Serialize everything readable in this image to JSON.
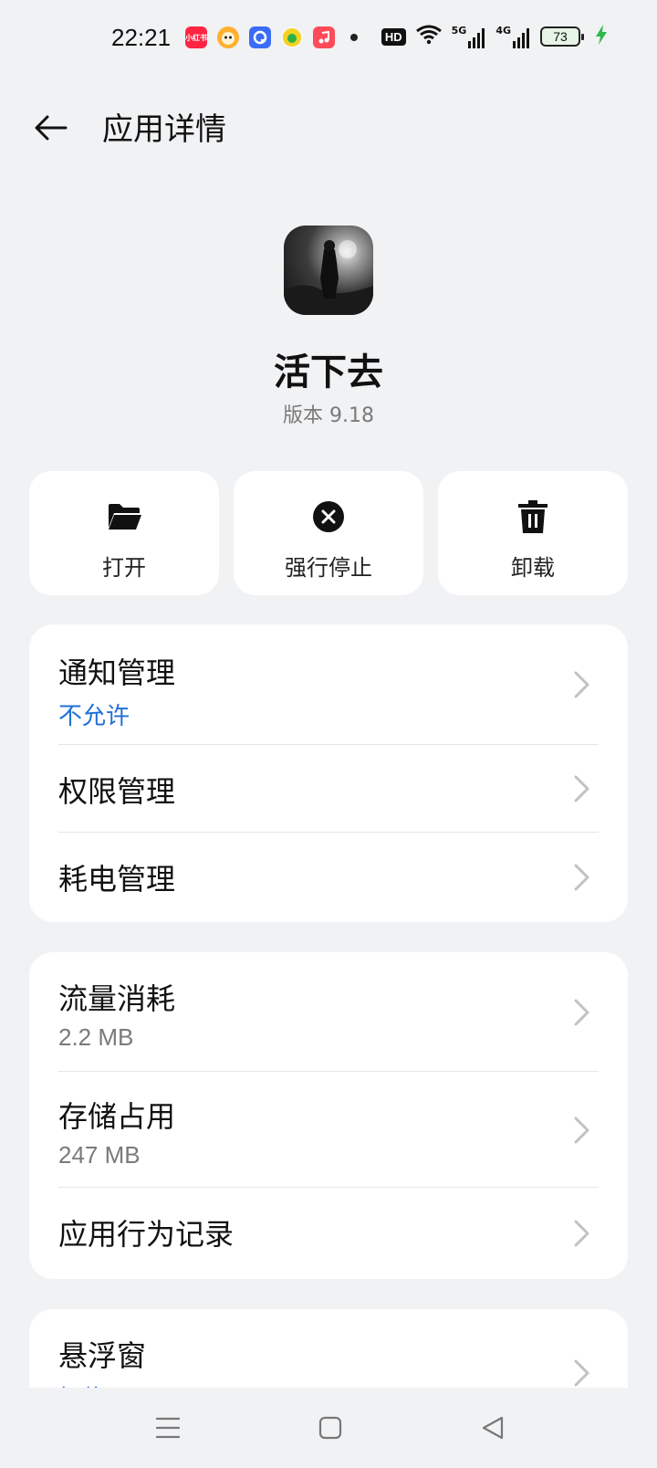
{
  "status_bar": {
    "time": "22:21",
    "hd": "HD",
    "net_5g": "5G",
    "net_4g": "4G",
    "battery": "73",
    "notification_icons": [
      {
        "name": "xiaohongshu-icon",
        "color": "#ff2442",
        "label": "小红书"
      },
      {
        "name": "taobao-mascot-icon",
        "color": "#ff9a1f"
      },
      {
        "name": "qq-browser-icon",
        "color": "#3b6cf6"
      },
      {
        "name": "qq-music-icon",
        "color": "#f4d21f"
      },
      {
        "name": "music-icon",
        "color": "#ff4a4a"
      }
    ]
  },
  "header": {
    "title": "应用详情"
  },
  "app": {
    "name": "活下去",
    "version": "版本 9.18"
  },
  "actions": [
    {
      "label": "打开",
      "icon": "folder-icon"
    },
    {
      "label": "强行停止",
      "icon": "stop-icon"
    },
    {
      "label": "卸载",
      "icon": "trash-icon"
    }
  ],
  "group1": {
    "notification": {
      "title": "通知管理",
      "sub": "不允许"
    },
    "permission": {
      "title": "权限管理"
    },
    "power": {
      "title": "耗电管理"
    }
  },
  "group2": {
    "data_usage": {
      "title": "流量消耗",
      "sub": "2.2 MB"
    },
    "storage": {
      "title": "存储占用",
      "sub": "247 MB"
    },
    "behavior": {
      "title": "应用行为记录"
    }
  },
  "group3": {
    "floating": {
      "title": "悬浮窗",
      "sub": "拒绝"
    }
  },
  "colors": {
    "accent_blue": "#1f6fd6",
    "background": "#f1f2f4",
    "card": "#ffffff"
  }
}
